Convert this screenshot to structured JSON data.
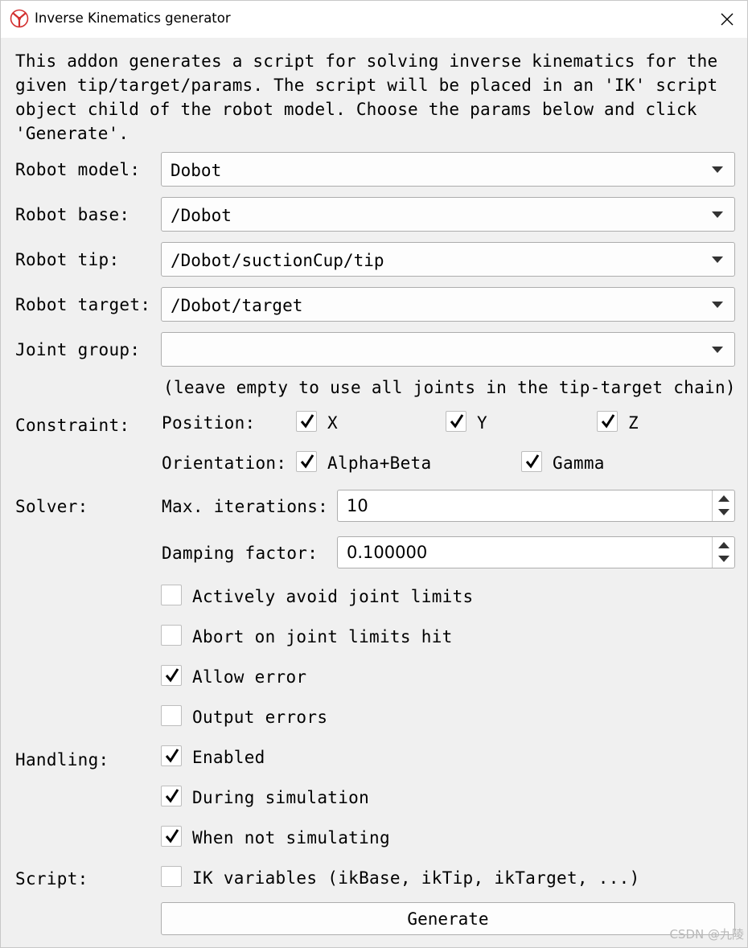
{
  "window": {
    "title": "Inverse Kinematics generator",
    "app_icon": "coppeliasim-logo-icon",
    "close_icon": "close-icon"
  },
  "intro": "This addon generates a script for solving inverse kinematics for the\ngiven tip/target/params. The script will be placed in an 'IK' script\nobject child of the robot model. Choose the params below and click\n'Generate'.",
  "fields": {
    "robot_model": {
      "label": "Robot model:",
      "value": "Dobot"
    },
    "robot_base": {
      "label": "Robot base:",
      "value": "/Dobot"
    },
    "robot_tip": {
      "label": "Robot tip:",
      "value": "/Dobot/suctionCup/tip"
    },
    "robot_target": {
      "label": "Robot target:",
      "value": "/Dobot/target"
    },
    "joint_group": {
      "label": "Joint group:",
      "value": "",
      "hint": "(leave empty to use all joints in the tip-target chain)"
    }
  },
  "constraint": {
    "label": "Constraint:",
    "position_label": "Position:",
    "x": {
      "label": "X",
      "checked": true
    },
    "y": {
      "label": "Y",
      "checked": true
    },
    "z": {
      "label": "Z",
      "checked": true
    },
    "orientation_label": "Orientation:",
    "alpha_beta": {
      "label": "Alpha+Beta",
      "checked": true
    },
    "gamma": {
      "label": "Gamma",
      "checked": true
    }
  },
  "solver": {
    "label": "Solver:",
    "max_iterations": {
      "label": "Max. iterations:",
      "value": "10"
    },
    "damping": {
      "label": "Damping factor:",
      "value": "0.100000"
    },
    "avoid_limits": {
      "label": "Actively avoid joint limits",
      "checked": false
    },
    "abort_limits": {
      "label": "Abort on joint limits hit",
      "checked": false
    },
    "allow_error": {
      "label": "Allow error",
      "checked": true
    },
    "output_errors": {
      "label": "Output errors",
      "checked": false
    }
  },
  "handling": {
    "label": "Handling:",
    "enabled": {
      "label": "Enabled",
      "checked": true
    },
    "during_sim": {
      "label": "During simulation",
      "checked": true
    },
    "not_sim": {
      "label": "When not simulating",
      "checked": true
    }
  },
  "script": {
    "label": "Script:",
    "ik_vars": {
      "label": "IK variables (ikBase, ikTip, ikTarget, ...)",
      "checked": false
    }
  },
  "generate_label": "Generate",
  "watermark": "CSDN @九陵"
}
